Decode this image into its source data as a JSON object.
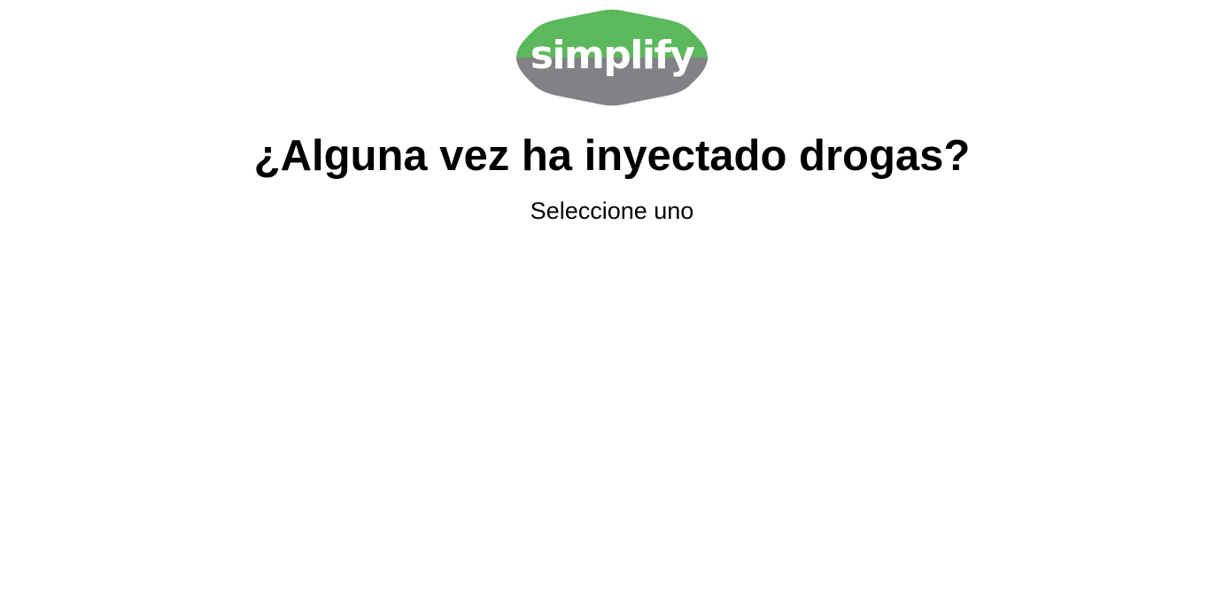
{
  "brand": {
    "logo_text": "simplify",
    "logo_top_color": "#5cb85c",
    "logo_bottom_color": "#808285",
    "logo_text_color": "#ffffff"
  },
  "question": {
    "title": "¿Alguna vez ha inyectado drogas?",
    "subtitle": "Seleccione uno"
  }
}
